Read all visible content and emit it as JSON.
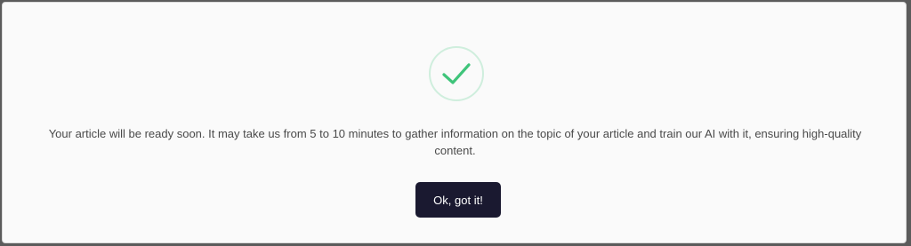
{
  "dialog": {
    "icon": "check-icon",
    "icon_color": "#3fc47a",
    "message": "Your article will be ready soon. It may take us from 5 to 10 minutes to gather information on the topic of your article and train our AI with it, ensuring high-quality content.",
    "ok_label": "Ok, got it!",
    "button_color": "#1a1930"
  }
}
